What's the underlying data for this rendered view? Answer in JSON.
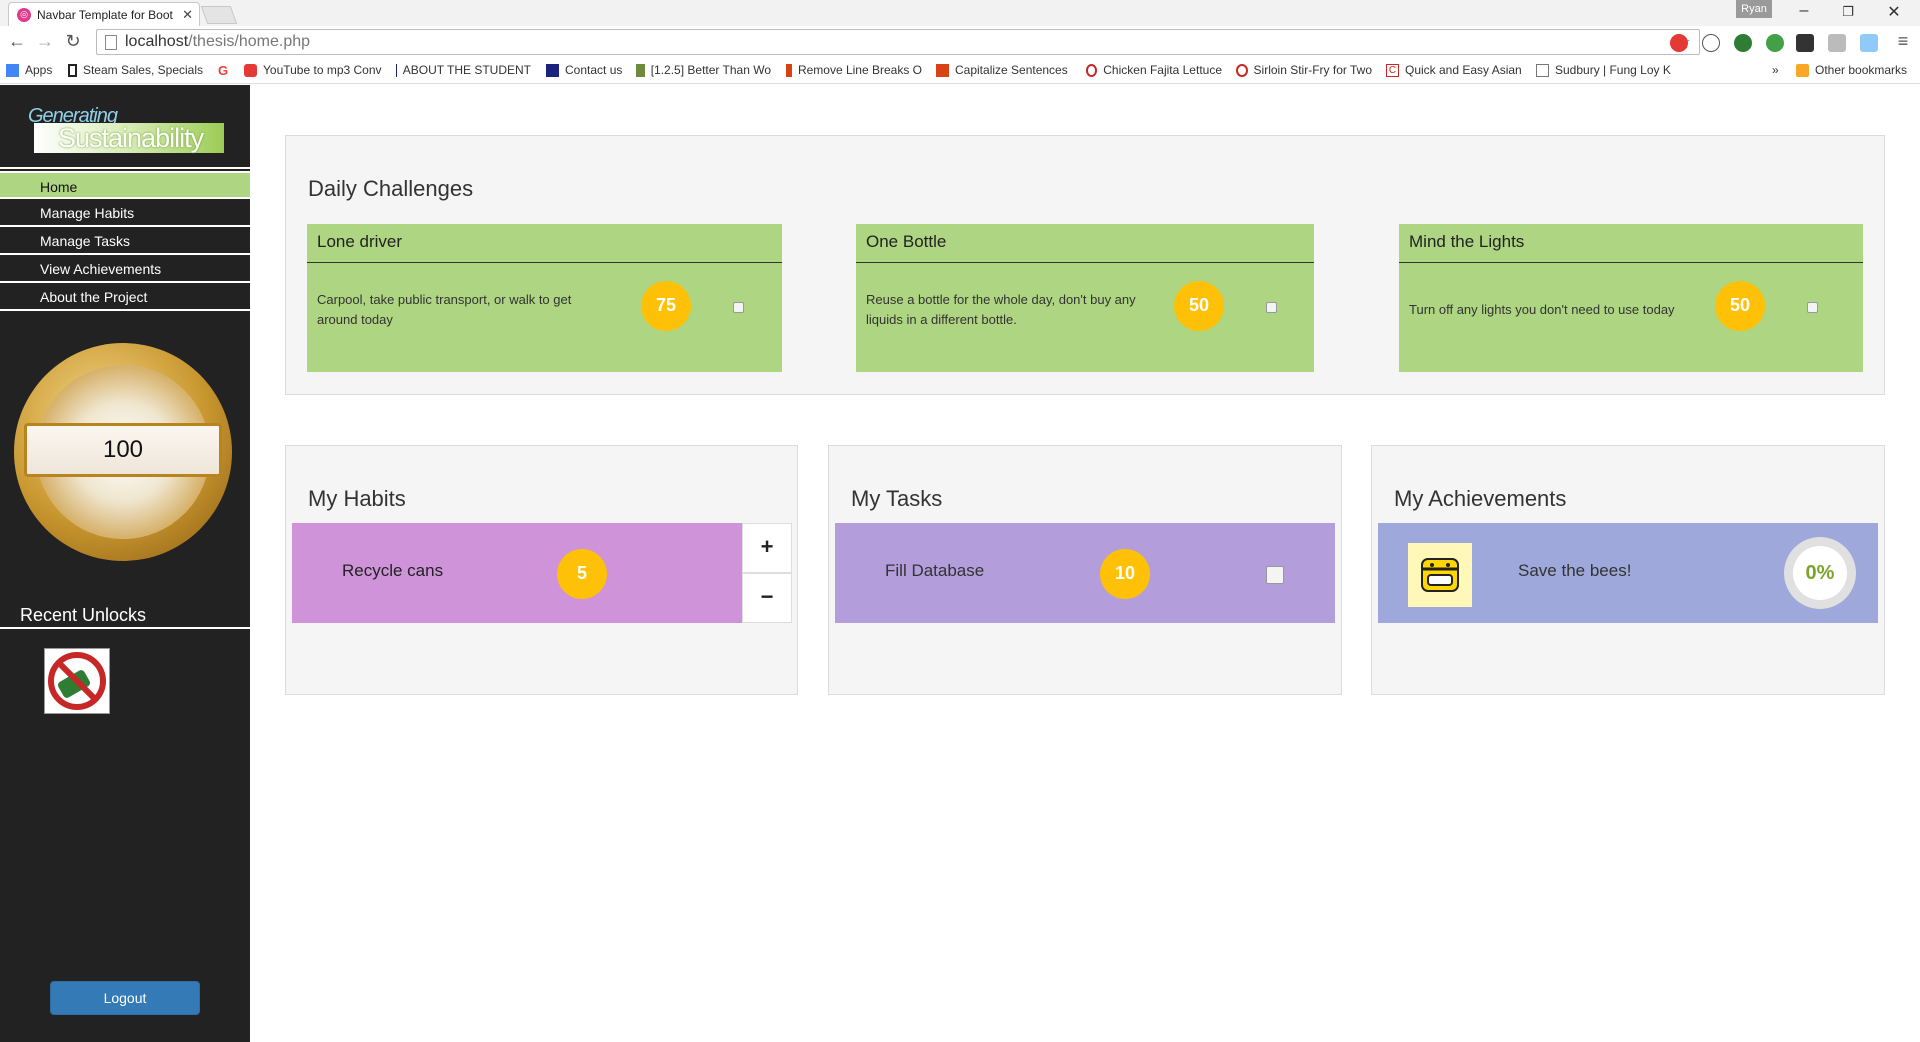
{
  "browser": {
    "tab_title": "Navbar Template for Boot",
    "profile": "Ryan",
    "url_host": "localhost",
    "url_path": "/thesis/home.php",
    "bookmarks": [
      {
        "label": "Apps",
        "color": "#4285f4"
      },
      {
        "label": "Steam Sales, Specials",
        "color": "#222222"
      },
      {
        "label": "",
        "color": "#ea4335"
      },
      {
        "label": "YouTube to mp3 Conv",
        "color": "#e53935"
      },
      {
        "label": "ABOUT THE STUDENT",
        "color": "#1a237e"
      },
      {
        "label": "Contact us",
        "color": "#1a237e"
      },
      {
        "label": "[1.2.5] Better Than Wo",
        "color": "#6d8b3a"
      },
      {
        "label": "Remove Line Breaks O",
        "color": "#d84315"
      },
      {
        "label": "Capitalize Sentences",
        "color": "#d84315"
      },
      {
        "label": "Chicken Fajita Lettuce",
        "color": "#c62828"
      },
      {
        "label": "Sirloin Stir-Fry for Two",
        "color": "#c62828"
      },
      {
        "label": "Quick and Easy Asian",
        "color": "#c62828"
      },
      {
        "label": "Sudbury | Fung Loy K",
        "color": "#777777"
      }
    ],
    "overflow": "»",
    "other_bookmarks": "Other bookmarks"
  },
  "sidebar": {
    "logo_line1": "Generating",
    "logo_line2": "Sustainability",
    "menu": [
      "Home",
      "Manage Habits",
      "Manage Tasks",
      "View Achievements",
      "About the Project"
    ],
    "active_index": 0,
    "points": "100",
    "recent_title": "Recent Unlocks",
    "logout": "Logout"
  },
  "daily": {
    "title": "Daily Challenges",
    "challenges": [
      {
        "title": "Lone driver",
        "desc": "Carpool, take public transport, or walk to get around today",
        "points": "75"
      },
      {
        "title": "One Bottle",
        "desc": "Reuse a bottle for the whole day, don't buy any liquids in a different bottle.",
        "points": "50"
      },
      {
        "title": "Mind the Lights",
        "desc": "Turn off any lights you don't need to use today",
        "points": "50"
      }
    ]
  },
  "habits": {
    "title": "My Habits",
    "item": "Recycle cans",
    "points": "5",
    "plus": "+",
    "minus": "−",
    "color": "#ce93d8"
  },
  "tasks": {
    "title": "My Tasks",
    "item": "Fill Database",
    "points": "10",
    "color": "#b39ddb"
  },
  "achievements": {
    "title": "My Achievements",
    "item": "Save the bees!",
    "progress": "0%",
    "color": "#9fa8da"
  }
}
